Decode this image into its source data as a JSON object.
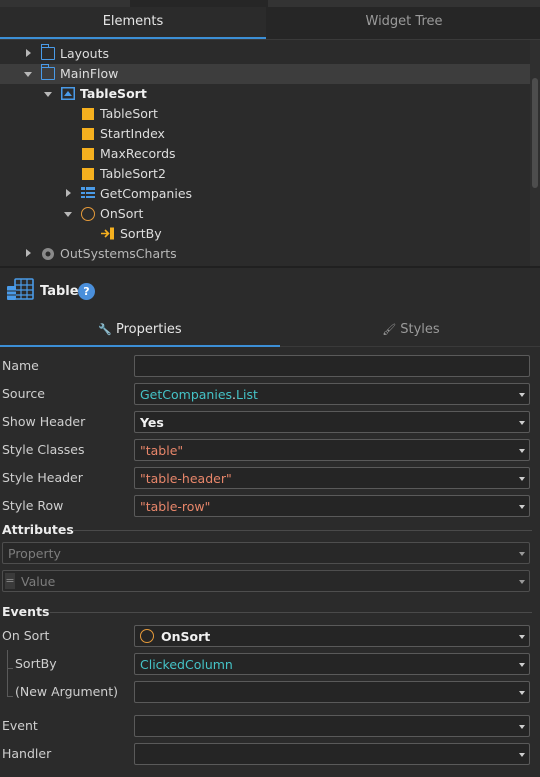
{
  "tabs": {
    "elements": "Elements",
    "widget_tree": "Widget Tree"
  },
  "tree": {
    "items": [
      {
        "label": "Layouts",
        "icon": "folder-icon"
      },
      {
        "label": "MainFlow",
        "icon": "folder-icon"
      },
      {
        "label": "TableSort",
        "icon": "screen-icon"
      },
      {
        "label": "TableSort",
        "icon": "local-variable-icon"
      },
      {
        "label": "StartIndex",
        "icon": "local-variable-icon"
      },
      {
        "label": "MaxRecords",
        "icon": "local-variable-icon"
      },
      {
        "label": "TableSort2",
        "icon": "local-variable-icon"
      },
      {
        "label": "GetCompanies",
        "icon": "aggregate-icon"
      },
      {
        "label": "OnSort",
        "icon": "action-circle-icon"
      },
      {
        "label": "SortBy",
        "icon": "input-parameter-icon"
      },
      {
        "label": "OutSystemsCharts",
        "icon": "module-icon"
      }
    ]
  },
  "header": {
    "title": "Table",
    "help": "?"
  },
  "prop_tabs": {
    "properties": "Properties",
    "styles": "Styles"
  },
  "props": {
    "name_label": "Name",
    "name_value": "",
    "source_label": "Source",
    "source_value_a": "GetCompanies",
    "source_dot": ".",
    "source_value_b": "List",
    "show_header_label": "Show Header",
    "show_header_value": "Yes",
    "style_classes_label": "Style Classes",
    "style_classes_value": "\"table\"",
    "style_header_label": "Style Header",
    "style_header_value": "\"table-header\"",
    "style_row_label": "Style Row",
    "style_row_value": "\"table-row\""
  },
  "attributes": {
    "title": "Attributes",
    "property_placeholder": "Property",
    "value_eq": "=",
    "value_placeholder": "Value"
  },
  "events": {
    "title": "Events",
    "on_sort_label": "On Sort",
    "on_sort_value": "OnSort",
    "sortby_label": "SortBy",
    "sortby_value": "ClickedColumn",
    "new_arg_label": "(New Argument)",
    "event_label": "Event",
    "handler_label": "Handler"
  },
  "colors": {
    "accent": "#3c8fd6",
    "variable": "#f5b01f",
    "expr": "#45c3c7",
    "string": "#e8866a"
  }
}
